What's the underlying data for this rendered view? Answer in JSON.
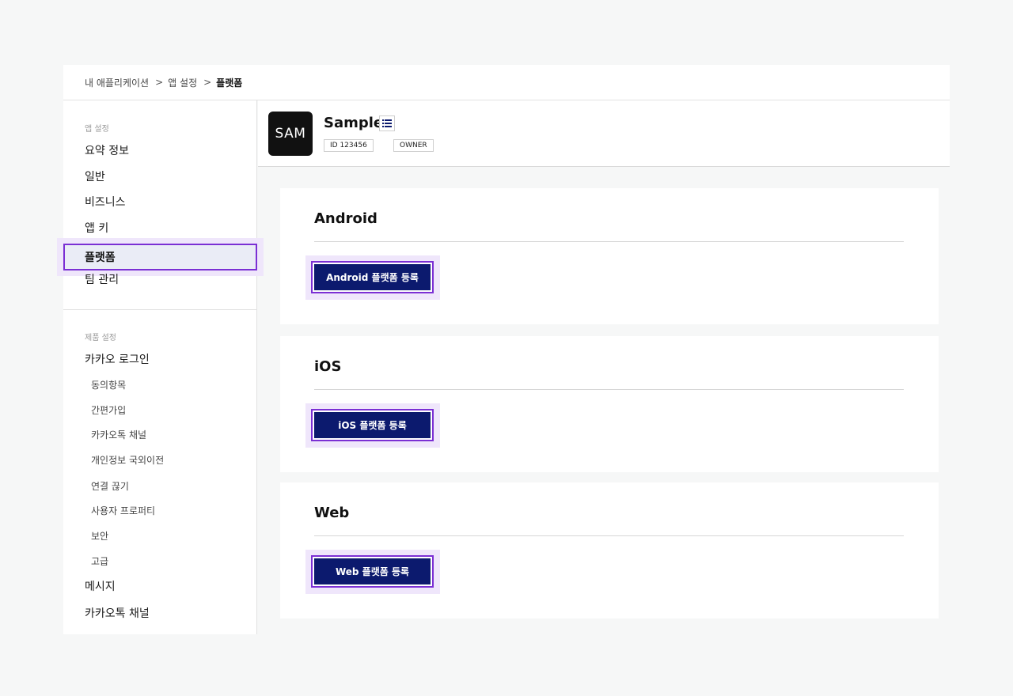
{
  "breadcrumb": {
    "items": [
      "내 애플리케이션",
      "앱 설정",
      "플랫폼"
    ],
    "separator": ">"
  },
  "sidebar": {
    "section1_title": "앱 설정",
    "section1_items": [
      "요약 정보",
      "일반",
      "비즈니스",
      "앱 키",
      "플랫폼",
      "팀 관리"
    ],
    "active_item": "플랫폼",
    "section2_title": "제품 설정",
    "kakao_login": "카카오 로그인",
    "kakao_login_sub": [
      "동의항목",
      "간편가입",
      "카카오톡 채널",
      "개인정보 국외이전",
      "연결 끊기",
      "사용자 프로퍼티",
      "보안",
      "고급"
    ],
    "message": "메시지",
    "kakaotalk_channel": "카카오톡 채널"
  },
  "app": {
    "logo_text": "SAM",
    "name": "Sample",
    "menu_icon": "list-icon",
    "tags": [
      "ID 123456",
      "OWNER"
    ]
  },
  "platforms": [
    {
      "title": "Android",
      "button": "Android 플랫폼 등록"
    },
    {
      "title": "iOS",
      "button": "iOS 플랫폼 등록"
    },
    {
      "title": "Web",
      "button": "Web 플랫폼 등록"
    }
  ],
  "colors": {
    "primary_button": "#0c1a6e",
    "focus_outline": "#7b2fd4",
    "focus_halo": "#efe6fb",
    "active_nav_bg": "#eaecf6",
    "page_bg": "#f6f7f7"
  }
}
